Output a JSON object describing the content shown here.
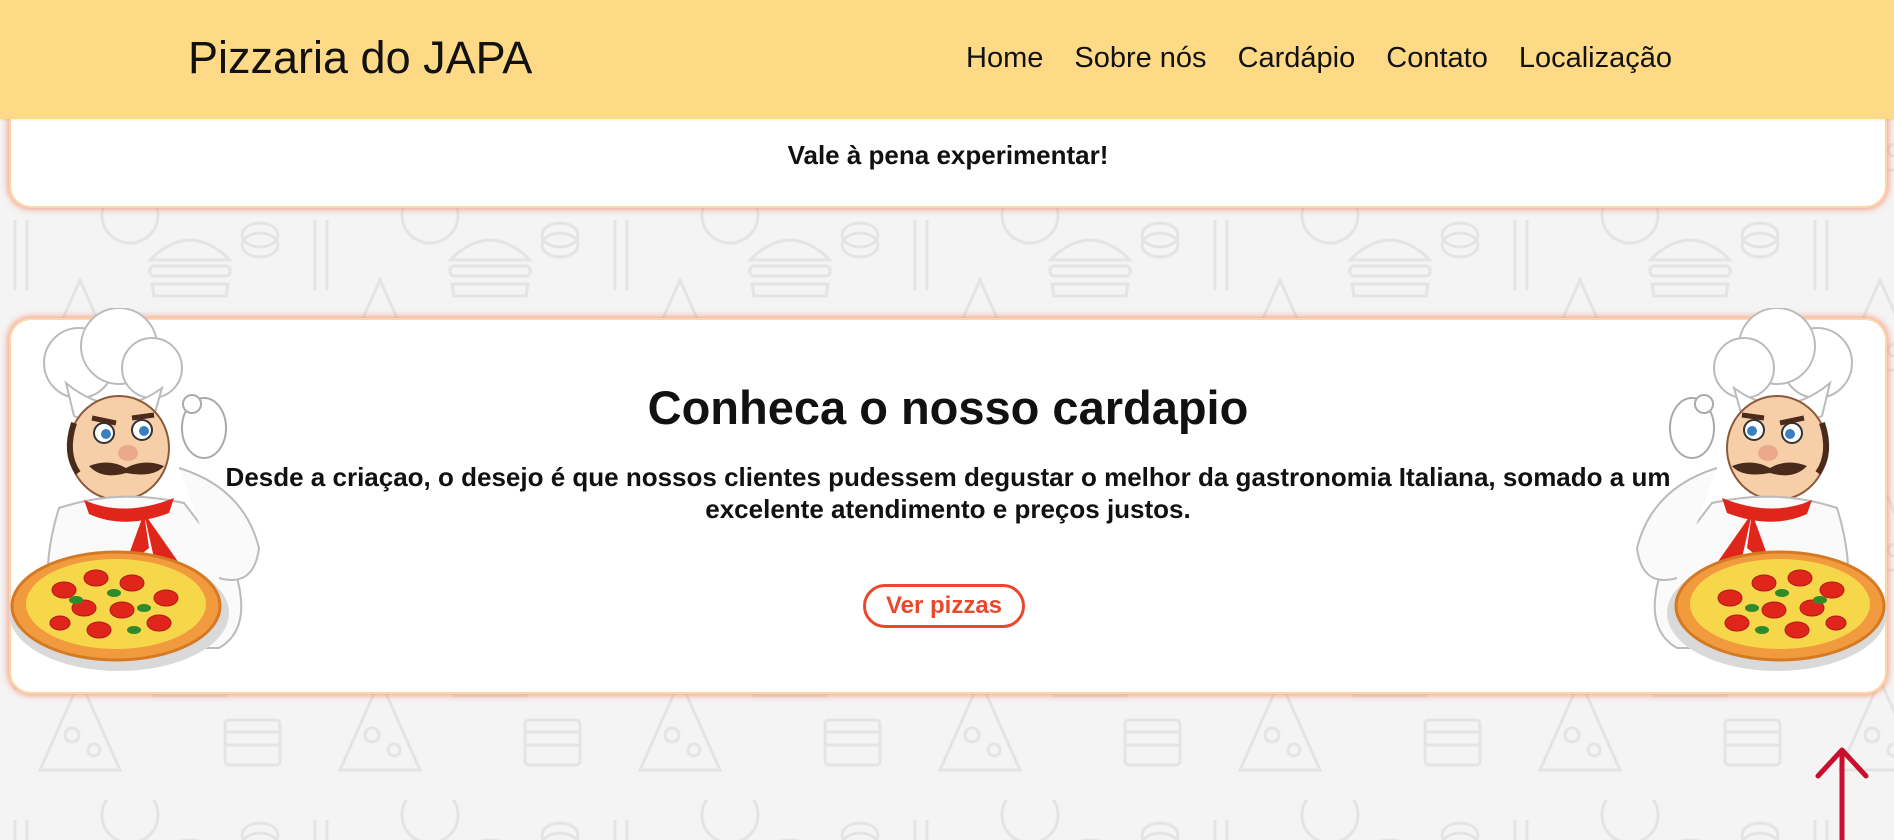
{
  "navbar": {
    "brand": "Pizzaria do JAPA",
    "links": [
      "Home",
      "Sobre nós",
      "Cardápio",
      "Contato",
      "Localização"
    ],
    "background": "#fed986"
  },
  "intro_card": {
    "tagline": "Vale à pena experimentar!"
  },
  "menu_card": {
    "title": "Conheca o nosso cardapio",
    "description": "Desde a criaçao, o desejo é que nossos clientes pudessem degustar o melhor da gastronomia Italiana, somado a um excelente atendimento e preços justos.",
    "button_label": "Ver pizzas"
  },
  "icons": {
    "chef_left": "chef-with-pizza-icon",
    "chef_right": "chef-with-pizza-icon",
    "back_to_top": "arrow-up-icon",
    "background": "food-doodle-pattern"
  },
  "colors": {
    "accent": "#e8492d",
    "card_glow": "#fa6e46",
    "arrow": "#c8102e",
    "page_bg": "#f4f4f4"
  }
}
